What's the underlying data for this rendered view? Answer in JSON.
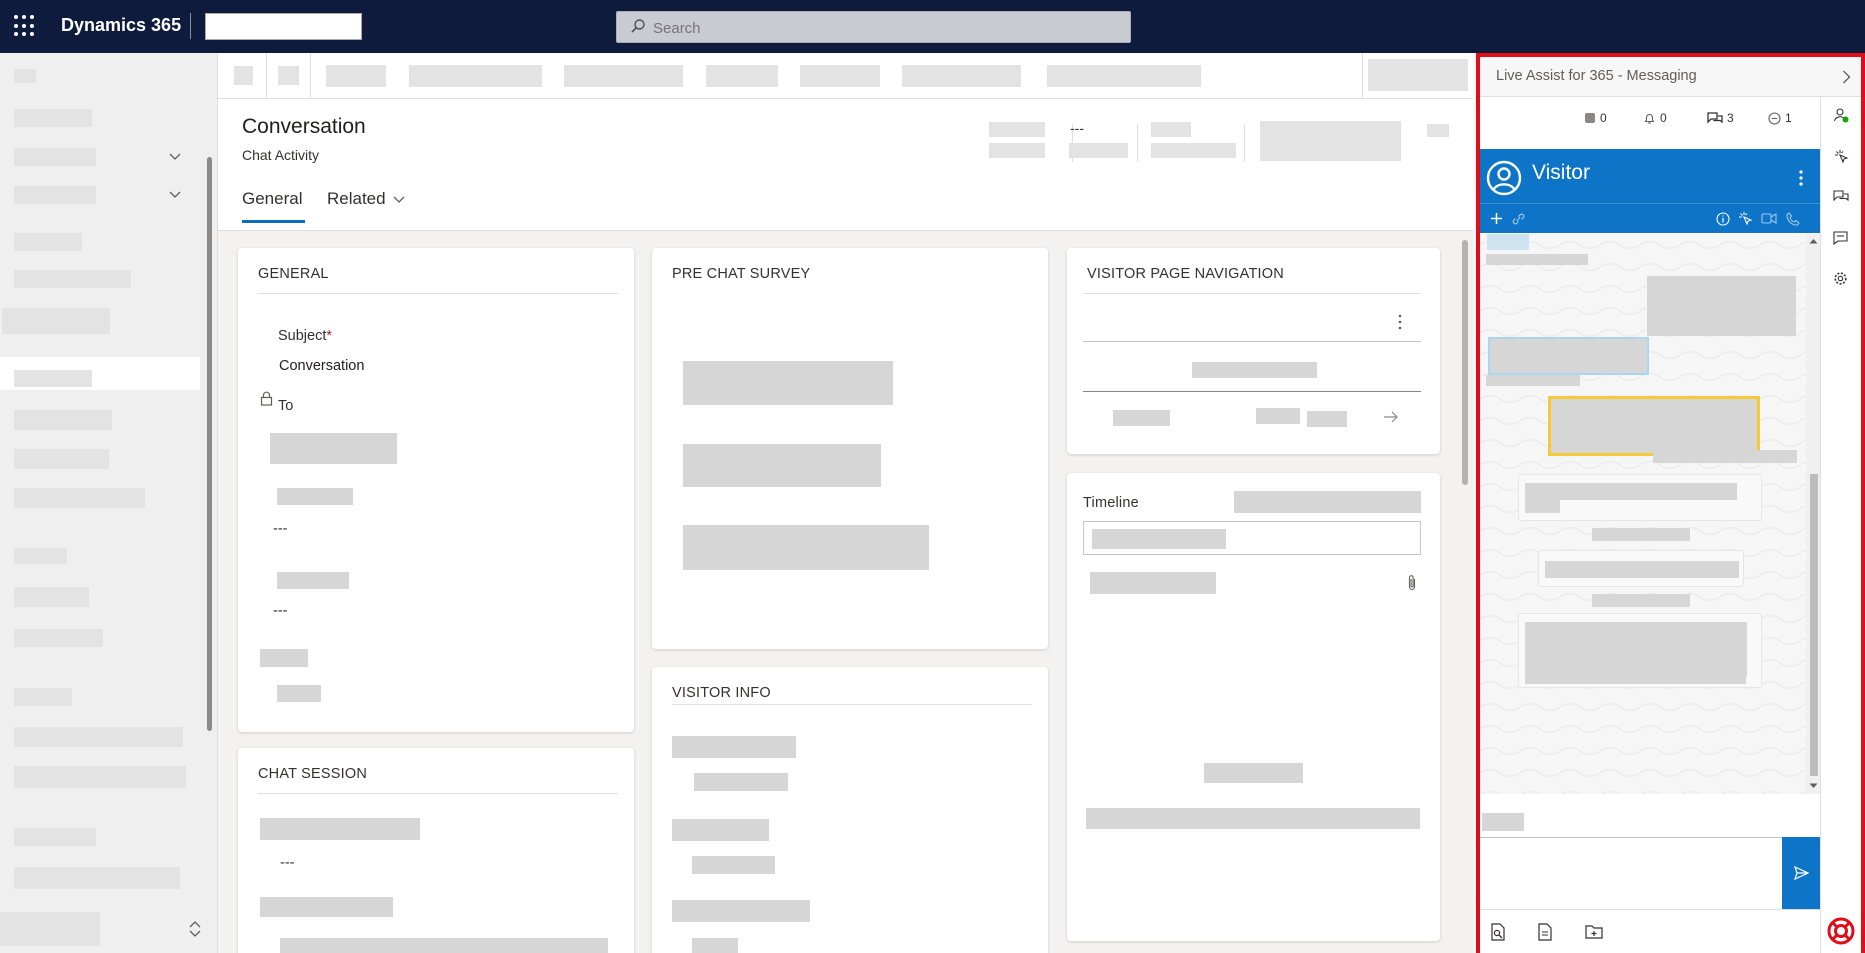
{
  "topbar": {
    "brand": "Dynamics 365",
    "search_placeholder": "Search"
  },
  "header": {
    "title": "Conversation",
    "subtitle": "Chat Activity",
    "field_value": "---",
    "tabs": [
      "General",
      "Related"
    ]
  },
  "general_card": {
    "title": "GENERAL",
    "subject_label": "Subject",
    "required_mark": "*",
    "subject_value": "Conversation",
    "to_label": "To",
    "empty_value_1": "---",
    "empty_value_2": "---"
  },
  "prechat_card": {
    "title": "PRE CHAT SURVEY"
  },
  "visitor_nav_card": {
    "title": "VISITOR PAGE NAVIGATION"
  },
  "timeline_card": {
    "title": "Timeline"
  },
  "visitor_info_card": {
    "title": "VISITOR INFO"
  },
  "chat_session_card": {
    "title": "CHAT SESSION",
    "empty_value": "---"
  },
  "panel": {
    "title": "Live Assist for 365 - Messaging",
    "counts": {
      "first": "0",
      "notifications": "0",
      "chats": "3",
      "minus": "1"
    },
    "visitor_name": "Visitor"
  },
  "colors": {
    "topbar": "#0f1b3d",
    "accent_blue": "#0d74c7",
    "panel_border": "#e10e1a",
    "highlight_yellow": "#f5c938",
    "highlight_lightblue": "#a9d7f0"
  }
}
